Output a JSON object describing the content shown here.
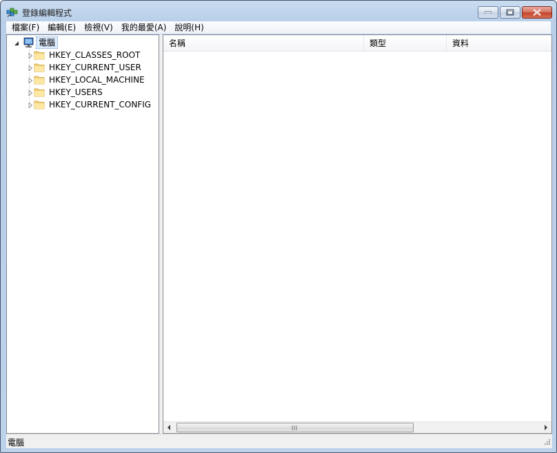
{
  "window": {
    "title": "登錄編輯程式",
    "icon": "registry-editor-icon"
  },
  "menu": [
    {
      "label": "檔案(F)"
    },
    {
      "label": "編輯(E)"
    },
    {
      "label": "檢視(V)"
    },
    {
      "label": "我的最愛(A)"
    },
    {
      "label": "說明(H)"
    }
  ],
  "tree": {
    "root": {
      "label": "電腦",
      "icon": "computer-icon",
      "expanded": true
    },
    "children": [
      {
        "label": "HKEY_CLASSES_ROOT",
        "icon": "folder-icon"
      },
      {
        "label": "HKEY_CURRENT_USER",
        "icon": "folder-icon"
      },
      {
        "label": "HKEY_LOCAL_MACHINE",
        "icon": "folder-icon"
      },
      {
        "label": "HKEY_USERS",
        "icon": "folder-icon"
      },
      {
        "label": "HKEY_CURRENT_CONFIG",
        "icon": "folder-icon"
      }
    ]
  },
  "list": {
    "columns": [
      {
        "label": "名稱"
      },
      {
        "label": "類型"
      },
      {
        "label": "資料"
      }
    ],
    "rows": []
  },
  "status": {
    "text": "電腦"
  },
  "colors": {
    "selection": "#dcebfc",
    "border": "#828790"
  }
}
